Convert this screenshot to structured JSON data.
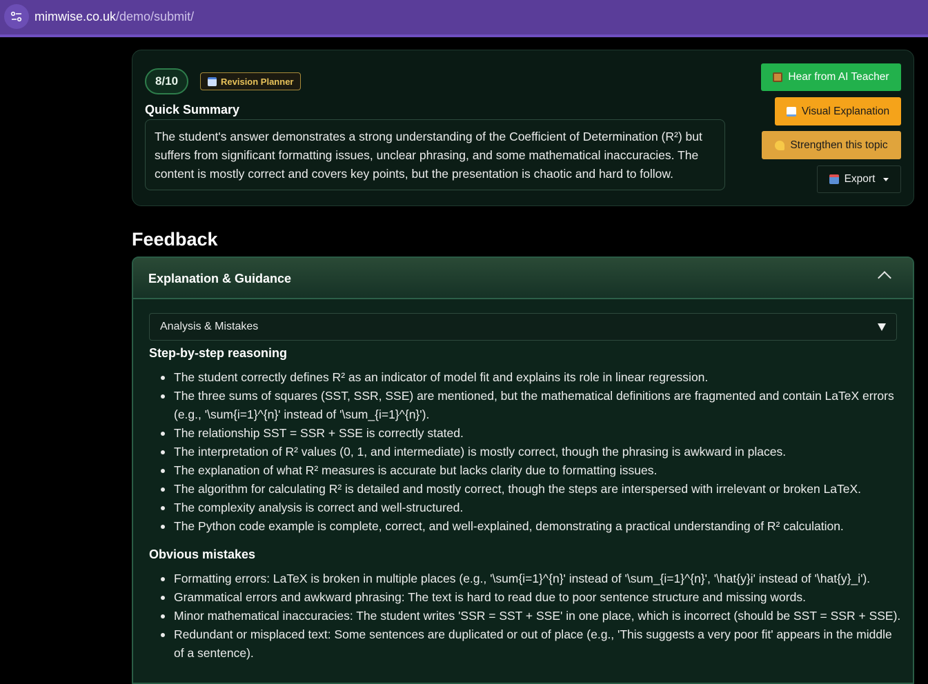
{
  "browser": {
    "url_domain": "mimwise.co.uk",
    "url_path": "/demo/submit/"
  },
  "summary": {
    "score": "8/10",
    "planner_label": "Revision Planner",
    "title": "Quick Summary",
    "text": "The student's answer demonstrates a strong understanding of the Coefficient of Determination (R²) but suffers from significant formatting issues, unclear phrasing, and some mathematical inaccuracies. The content is mostly correct and covers key points, but the presentation is chaotic and hard to follow."
  },
  "actions": {
    "ai_teacher": "Hear from AI Teacher",
    "visual": "Visual Explanation",
    "strengthen": "Strengthen this topic",
    "export": "Export"
  },
  "feedback": {
    "title": "Feedback",
    "panel_title": "Explanation & Guidance",
    "select_value": "Analysis & Mistakes",
    "reasoning_title": "Step-by-step reasoning",
    "reasoning": [
      "The student correctly defines R² as an indicator of model fit and explains its role in linear regression.",
      "The three sums of squares (SST, SSR, SSE) are mentioned, but the mathematical definitions are fragmented and contain LaTeX errors (e.g., '\\sum{i=1}^{n}' instead of '\\sum_{i=1}^{n}').",
      "The relationship SST = SSR + SSE is correctly stated.",
      "The interpretation of R² values (0, 1, and intermediate) is mostly correct, though the phrasing is awkward in places.",
      "The explanation of what R² measures is accurate but lacks clarity due to formatting issues.",
      "The algorithm for calculating R² is detailed and mostly correct, though the steps are interspersed with irrelevant or broken LaTeX.",
      "The complexity analysis is correct and well-structured.",
      "The Python code example is complete, correct, and well-explained, demonstrating a practical understanding of R² calculation."
    ],
    "mistakes_title": "Obvious mistakes",
    "mistakes": [
      "Formatting errors: LaTeX is broken in multiple places (e.g., '\\sum{i=1}^{n}' instead of '\\sum_{i=1}^{n}', '\\hat{y}i' instead of '\\hat{y}_i').",
      "Grammatical errors and awkward phrasing: The text is hard to read due to poor sentence structure and missing words.",
      "Minor mathematical inaccuracies: The student writes 'SSR = SST + SSE' in one place, which is incorrect (should be SST = SSR + SSE).",
      "Redundant or misplaced text: Some sentences are duplicated or out of place (e.g., 'This suggests a very poor fit' appears in the middle of a sentence)."
    ]
  },
  "colors": {
    "address_bar": "#5a3d99",
    "btn_green": "#22b14c",
    "btn_orange": "#f5a31a",
    "btn_gold": "#e0a43c"
  },
  "icons": {
    "site_info": "tune-icon",
    "planner": "calendar-icon",
    "ai_teacher": "teacher-icon",
    "visual": "book-icon",
    "strengthen": "flexed-arm-icon",
    "export": "outbox-icon"
  }
}
